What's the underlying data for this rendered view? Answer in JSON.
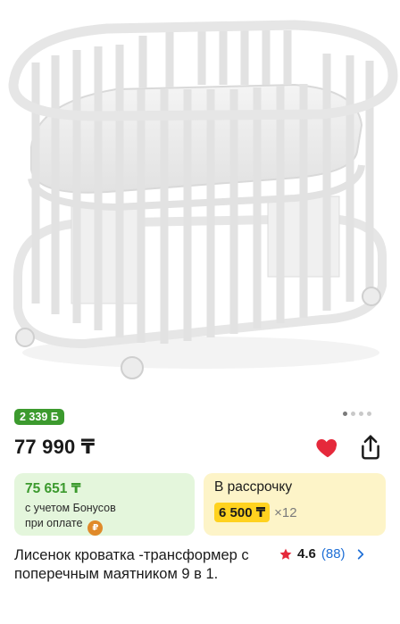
{
  "product": {
    "bonus_badge": "2 339 Б",
    "price": "77 990 ₸",
    "title": "Лисенок кроватка -трансформер с поперечным маятником 9 в 1.",
    "rating_value": "4.6",
    "rating_count": "(88)"
  },
  "gallery": {
    "slide_count": 4,
    "active_index": 0
  },
  "bonus_card": {
    "amount": "75 651 ₸",
    "line1": "с учетом Бонусов",
    "line2": "при оплате"
  },
  "installment_card": {
    "title": "В рассрочку",
    "monthly": "6 500 ₸",
    "multiplier": "×12"
  },
  "icons": {
    "favorite": "heart-icon",
    "share": "share-icon",
    "star": "star-icon",
    "chevron": "chevron-right-icon",
    "coin": "coin-icon"
  },
  "colors": {
    "badge_green": "#3c9a2e",
    "bonus_bg": "#e4f6dc",
    "installment_bg": "#fdf4c8",
    "installment_highlight": "#ffd21f",
    "heart_red": "#e5293b",
    "link_blue": "#1f6fd6"
  }
}
